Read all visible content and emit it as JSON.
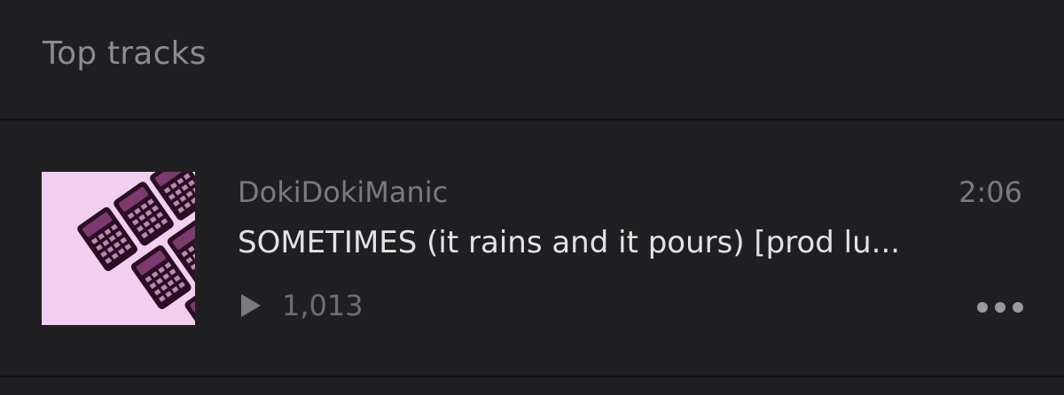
{
  "section": {
    "title": "Top tracks"
  },
  "tracks": [
    {
      "artist": "DokiDokiManic",
      "title": "SOMETIMES (it rains and it pours) [prod lu...",
      "duration": "2:06",
      "plays": "1,013",
      "play_icon": "play-triangle-icon",
      "more_icon": "more-dots-icon",
      "artwork_description": "pink-calculators-artwork"
    }
  ],
  "colors": {
    "background": "#1f1e20",
    "divider": "#121113",
    "primary_text": "#e3e2e4",
    "secondary_text": "#7b7a7c",
    "artwork_bg": "#f2cff0"
  }
}
